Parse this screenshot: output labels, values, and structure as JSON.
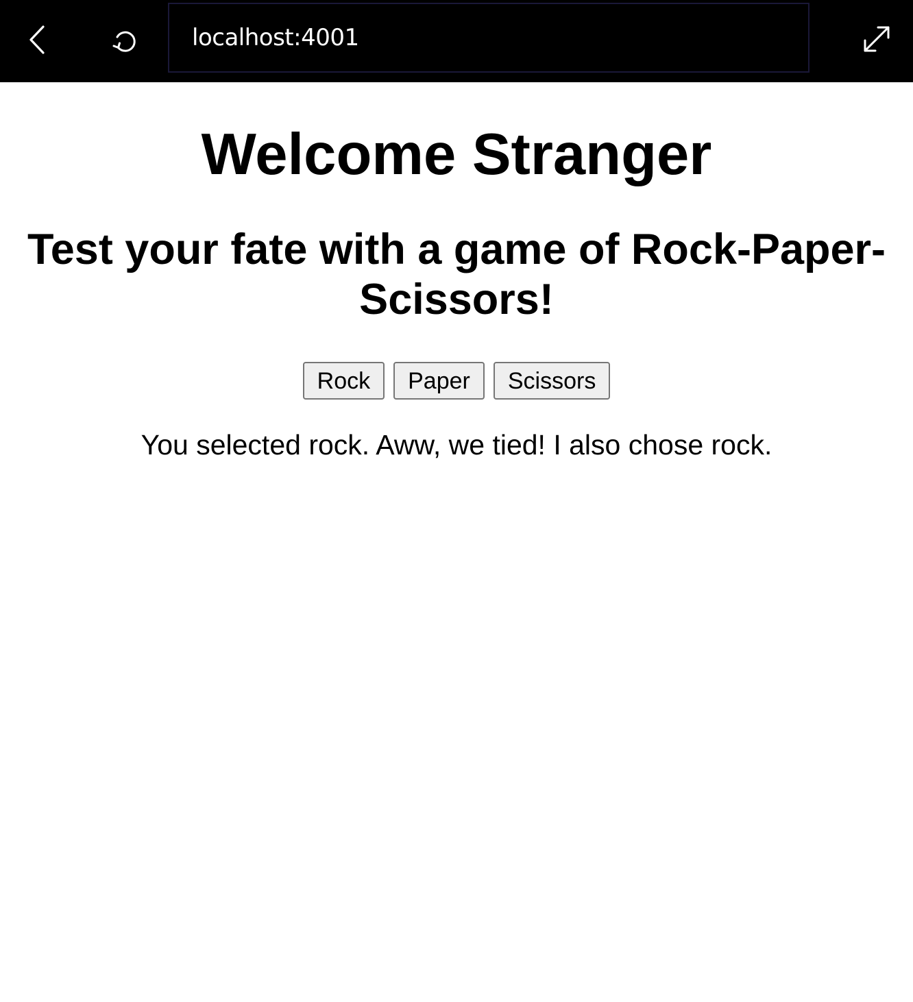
{
  "browser": {
    "url": "localhost:4001",
    "back_icon": "chevron-left-icon",
    "reload_icon": "reload-icon",
    "expand_icon": "expand-icon",
    "toolbar_color": "#000000"
  },
  "page": {
    "title": "Welcome Stranger",
    "subtitle": "Test your fate with a game of Rock-Paper-Scissors!",
    "choices": {
      "rock": "Rock",
      "paper": "Paper",
      "scissors": "Scissors"
    },
    "result": "You selected rock. Aww, we tied! I also chose rock."
  }
}
